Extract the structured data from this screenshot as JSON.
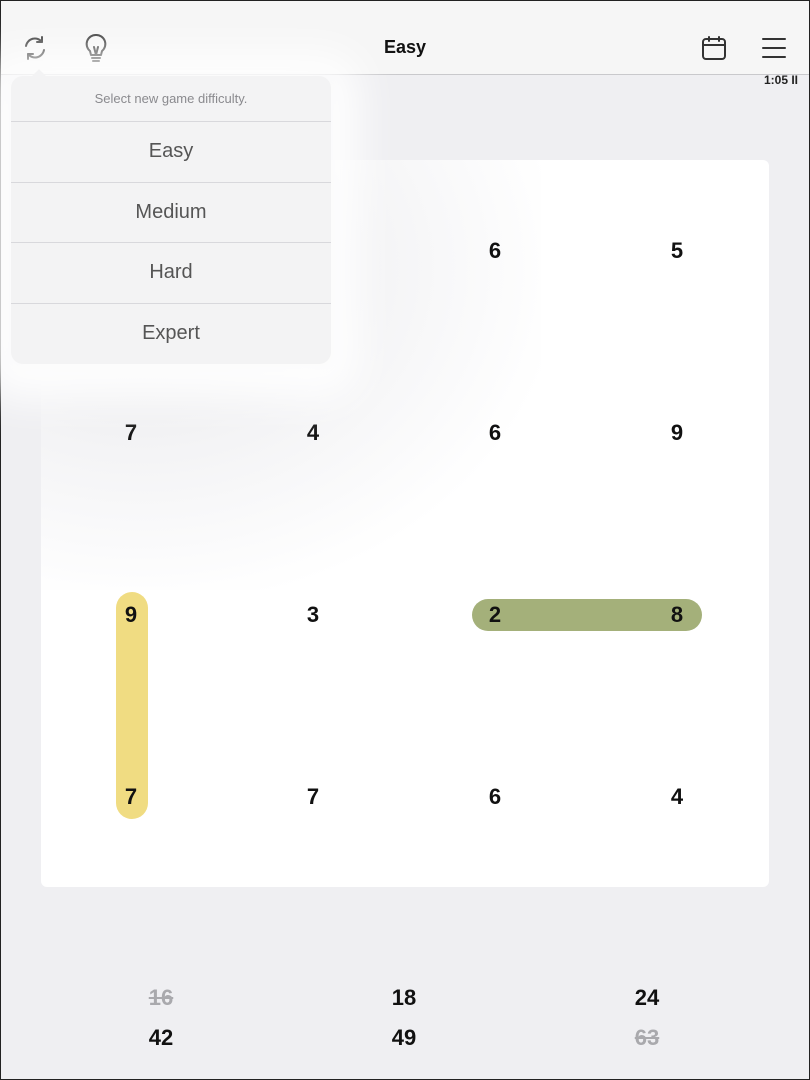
{
  "header": {
    "title": "Easy",
    "timer": "1:05 II",
    "icons": [
      "refresh-icon",
      "lightbulb-icon",
      "calendar-icon",
      "menu-icon"
    ]
  },
  "difficulty_popover": {
    "prompt": "Select new game difficulty.",
    "options": [
      "Easy",
      "Medium",
      "Hard",
      "Expert"
    ]
  },
  "board": {
    "rows": [
      [
        "",
        "",
        "6",
        "5"
      ],
      [
        "7",
        "4",
        "6",
        "9"
      ],
      [
        "9",
        "3",
        "2",
        "8"
      ],
      [
        "7",
        "7",
        "6",
        "4"
      ]
    ],
    "highlights": [
      {
        "cells": [
          [
            2,
            0
          ],
          [
            3,
            0
          ]
        ],
        "color": "#f0dc82"
      },
      {
        "cells": [
          [
            2,
            2
          ],
          [
            2,
            3
          ]
        ],
        "color": "#a4b07a"
      }
    ]
  },
  "targets": [
    {
      "value": "16",
      "done": true
    },
    {
      "value": "18",
      "done": false
    },
    {
      "value": "24",
      "done": false
    },
    {
      "value": "42",
      "done": false
    },
    {
      "value": "49",
      "done": false
    },
    {
      "value": "63",
      "done": true
    }
  ]
}
